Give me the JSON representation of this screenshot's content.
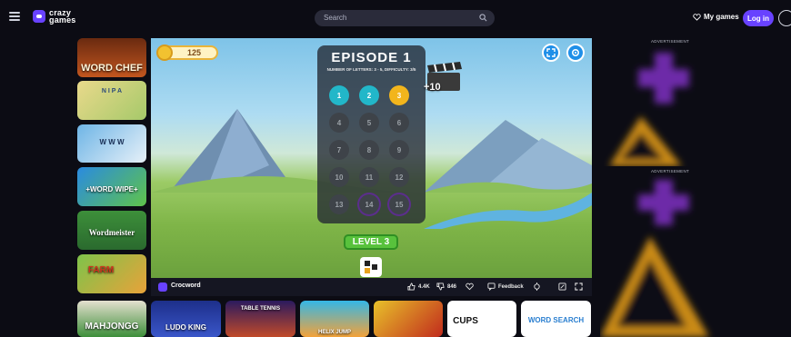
{
  "header": {
    "logo_line1": "crazy",
    "logo_line2": "games",
    "search_placeholder": "Search",
    "my_games_label": "My games",
    "login_label": "Log in"
  },
  "sidebar_games": [
    {
      "label": "WORD CHEF"
    },
    {
      "label": "N I P A"
    },
    {
      "label": "W W W"
    },
    {
      "label": "+WORD WIPE+"
    },
    {
      "label": "Wordmeister"
    },
    {
      "label": "FARM"
    }
  ],
  "game": {
    "coins": "125",
    "episode_title": "EPISODE 1",
    "episode_subtitle": "NUMBER OF LETTERS: 3 - 5, DIFFICULTY: 3/5",
    "levels": [
      {
        "num": "1",
        "state": "done"
      },
      {
        "num": "2",
        "state": "done"
      },
      {
        "num": "3",
        "state": "current"
      },
      {
        "num": "4",
        "state": "locked"
      },
      {
        "num": "5",
        "state": "locked"
      },
      {
        "num": "6",
        "state": "locked"
      },
      {
        "num": "7",
        "state": "locked"
      },
      {
        "num": "8",
        "state": "locked"
      },
      {
        "num": "9",
        "state": "locked"
      },
      {
        "num": "10",
        "state": "locked"
      },
      {
        "num": "11",
        "state": "locked"
      },
      {
        "num": "12",
        "state": "locked"
      },
      {
        "num": "13",
        "state": "locked"
      },
      {
        "num": "14",
        "state": "ring"
      },
      {
        "num": "15",
        "state": "ring"
      }
    ],
    "bonus": "+10",
    "level_banner": "LEVEL 3"
  },
  "game_bar": {
    "name": "Crocword",
    "likes": "4.4K",
    "dislikes": "846",
    "feedback_label": "Feedback"
  },
  "ads": {
    "label": "ADVERTISEMENT"
  },
  "bottom_games": [
    {
      "label": "MAHJONGG"
    },
    {
      "label": "LUDO KING"
    },
    {
      "label": "TABLE TENNIS"
    },
    {
      "label": "HELIX JUMP"
    },
    {
      "label": ""
    },
    {
      "label": "CUPS"
    },
    {
      "label": "WORD SEARCH"
    }
  ],
  "colors": {
    "accent": "#6842ff",
    "background": "#0c0c14"
  }
}
